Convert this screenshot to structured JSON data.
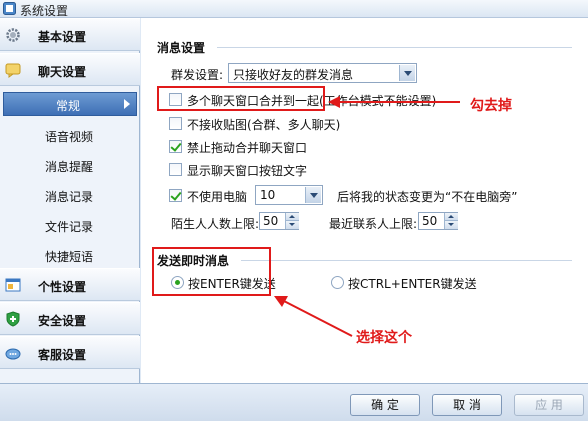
{
  "window": {
    "title": "系统设置"
  },
  "sidebar": {
    "categories": [
      {
        "label": "基本设置",
        "icon": "gear-icon"
      },
      {
        "label": "聊天设置",
        "icon": "chat-bubble-icon"
      },
      {
        "label": "个性设置",
        "icon": "personalize-window-icon"
      },
      {
        "label": "安全设置",
        "icon": "shield-icon"
      },
      {
        "label": "客服设置",
        "icon": "customer-service-icon"
      }
    ],
    "subitems": [
      "常规",
      "语音视频",
      "消息提醒",
      "消息记录",
      "文件记录",
      "快捷短语"
    ],
    "active_subitem": "常规"
  },
  "message_settings": {
    "title": "消息设置",
    "group_label": "群发设置:",
    "group_value": "只接收好友的群发消息",
    "options": [
      {
        "label": "多个聊天窗口合并到一起(工作台模式不能设置)",
        "checked": false
      },
      {
        "label": "不接收贴图(合群、多人聊天)",
        "checked": false
      },
      {
        "label": "禁止拖动合并聊天窗口",
        "checked": true
      },
      {
        "label": "显示聊天窗口按钮文字",
        "checked": false
      }
    ],
    "away": {
      "label": "不使用电脑",
      "checked": true,
      "minutes": "10",
      "suffix": "后将我的状态变更为“不在电脑旁”"
    },
    "stranger_limit_label": "陌生人人数上限:",
    "stranger_limit": "50",
    "recent_limit_label": "最近联系人上限:",
    "recent_limit": "50"
  },
  "send_settings": {
    "title": "发送即时消息",
    "options": [
      {
        "label": "按ENTER键发送",
        "checked": true
      },
      {
        "label": "按CTRL+ENTER键发送",
        "checked": false
      }
    ]
  },
  "annotations": {
    "uncheck": "勾去掉",
    "select": "选择这个"
  },
  "buttons": {
    "ok": "确 定",
    "cancel": "取 消",
    "apply": "应 用"
  },
  "colors": {
    "annotation_red": "#e01a1a",
    "check_green": "#2aa21f",
    "active_blue": "#3e6fb5"
  }
}
